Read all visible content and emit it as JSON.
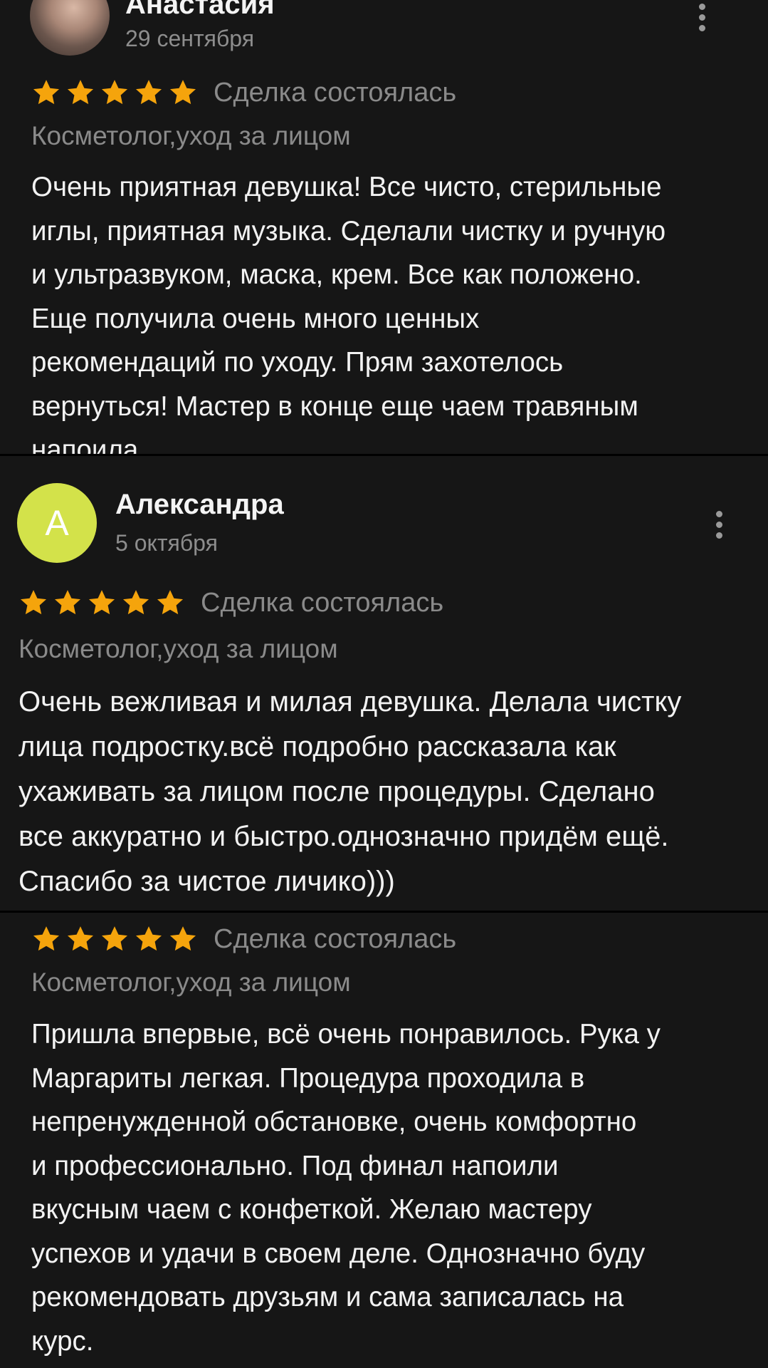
{
  "colors": {
    "background": "#000000",
    "card": "#161616",
    "star": "#f5a40c",
    "muted_text": "#8a8a8a",
    "avatar_letter_bg": "#d3e24a"
  },
  "icons": {
    "star": "star-icon",
    "more": "more-vertical-icon"
  },
  "reviews": [
    {
      "author": "Анастасия",
      "date": "29 сентября",
      "rating": 5,
      "deal_status": "Сделка состоялась",
      "service": "Косметолог,уход за лицом",
      "text_lines": [
        "Очень приятная девушка! Все чисто, стерильные",
        "иглы, приятная музыка. Сделали чистку и ручную",
        "и ультразвуком, маска, крем. Все как положено.",
        "Еще получила очень много ценных",
        "рекомендаций по уходу. Прям захотелось",
        "вернуться! Мастер в конце еще чаем травяным",
        "напоила"
      ]
    },
    {
      "author": "Александра",
      "avatar_letter": "А",
      "date": "5 октября",
      "rating": 5,
      "deal_status": "Сделка состоялась",
      "service": "Косметолог,уход за лицом",
      "text_lines": [
        "Очень вежливая и милая девушка. Делала чистку",
        "лица подростку.всё подробно рассказала как",
        "ухаживать за лицом после процедуры. Сделано",
        "все аккуратно и быстро.однозначно придём ещё.",
        "Спасибо за чистое личико)))"
      ]
    },
    {
      "rating": 5,
      "deal_status": "Сделка состоялась",
      "service": "Косметолог,уход за лицом",
      "text_lines": [
        "Пришла впервые, всё очень понравилось. Рука у",
        "Маргариты легкая. Процедура проходила в",
        "непренужденной обстановке, очень комфортно",
        "и профессионально. Под финал напоили",
        "вкусным чаем с конфеткой. Желаю мастеру",
        "успехов и удачи в своем деле. Однозначно буду",
        "рекомендовать друзьям и сама записалась на",
        "курс."
      ]
    }
  ]
}
